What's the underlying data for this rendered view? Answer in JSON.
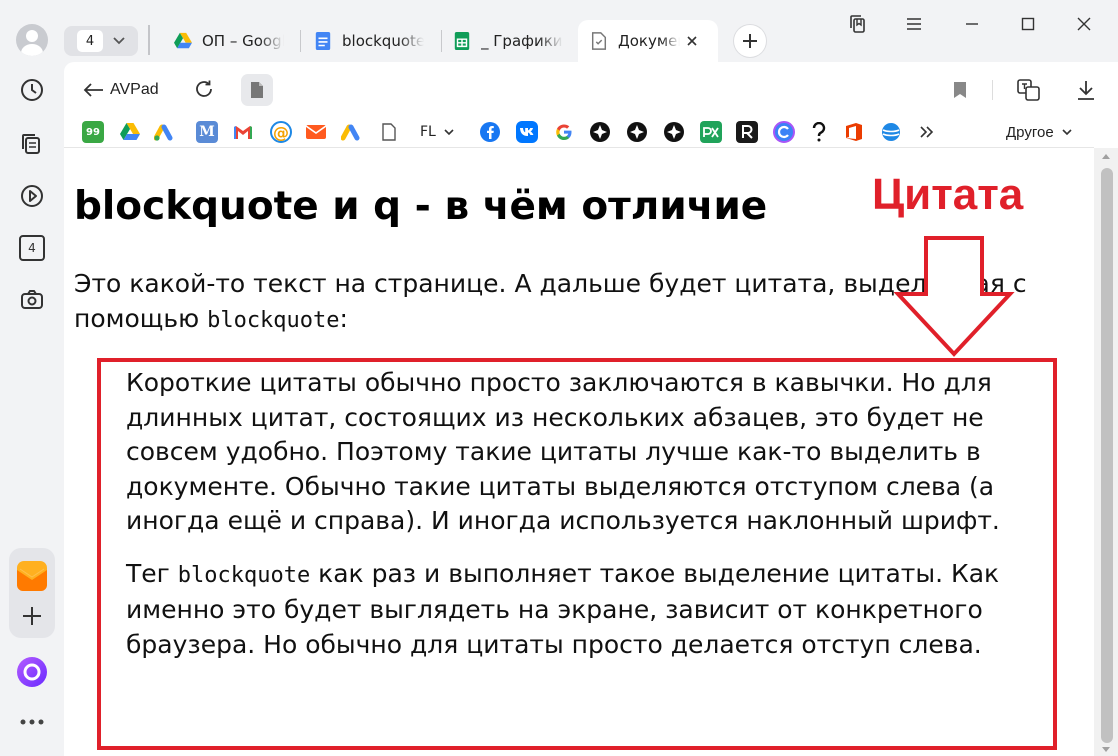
{
  "colors": {
    "accent": "#e0202a",
    "chrome_bg": "#f2f3f5",
    "page_bg": "#ffffff"
  },
  "tabs_counter": "4",
  "tabs": [
    {
      "title": "ОП – Google Диск",
      "icon": "google-drive-icon"
    },
    {
      "title": "blockquote",
      "icon": "google-docs-icon"
    },
    {
      "title": "_ Графики",
      "icon": "google-sheets-icon"
    },
    {
      "title": "Документ",
      "icon": "document-icon",
      "active": true
    }
  ],
  "sidebar": {
    "tabs_badge": "4"
  },
  "toolbar": {
    "back_label": "AVPad"
  },
  "bookmarks": {
    "items": [
      {
        "icon": "99-icon",
        "label": "99"
      },
      {
        "icon": "google-drive-icon"
      },
      {
        "icon": "google-ads-icon"
      },
      {
        "icon": "m-icon",
        "label": "M"
      },
      {
        "icon": "gmail-icon",
        "label": "M"
      },
      {
        "icon": "at-icon",
        "label": "@"
      },
      {
        "icon": "mail-icon"
      },
      {
        "icon": "ads-icon"
      },
      {
        "icon": "file-icon"
      }
    ],
    "folder_label": "FL",
    "other_label": "Другое"
  },
  "page": {
    "heading": "blockquote и q - в чём отличие",
    "intro_text": "Это какой-то текст на странице. А дальше будет цитата, выделенная с помощью ",
    "intro_code": "blockquote",
    "intro_end": ":",
    "quote_p1": "Короткие цитаты обычно просто заключаются в кавычки. Но для длинных цитат, состоящих из нескольких абзацев, это будет не совсем удобно. Поэтому такие цитаты лучше как-то выделить в документе. Обычно такие цитаты выделяются отступом слева (а иногда ещё и справа). И иногда используется наклонный шрифт.",
    "quote_p2_start": "Тег ",
    "quote_p2_code": "blockquote",
    "quote_p2_end": " как раз и выполняет такое выделение цитаты. Как именно это будет выглядеть на экране, зависит от конкретного браузера. Но обычно для цитаты просто делается отступ слева."
  },
  "annotation": {
    "label": "Цитата"
  }
}
